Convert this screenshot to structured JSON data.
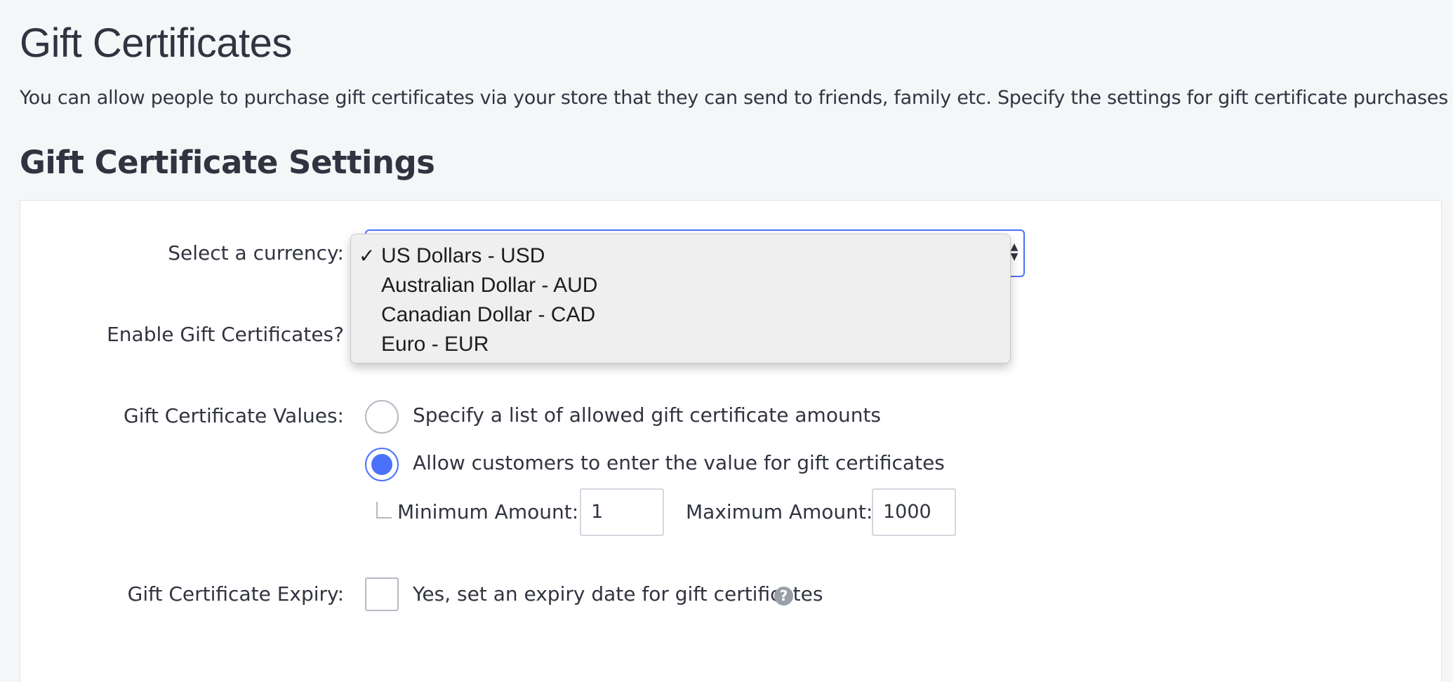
{
  "page": {
    "title": "Gift Certificates",
    "description": "You can allow people to purchase gift certificates via your store that they can send to friends, family etc. Specify the settings for gift certificate purchases below.",
    "section_title": "Gift Certificate Settings"
  },
  "currency": {
    "label": "Select a currency:",
    "selected": "US Dollars - USD",
    "check_glyph": "✓",
    "options": [
      "US Dollars - USD",
      "Australian Dollar - AUD",
      "Canadian Dollar - CAD",
      "Euro - EUR"
    ]
  },
  "enable": {
    "label": "Enable Gift Certificates?"
  },
  "values": {
    "label": "Gift Certificate Values:",
    "option_list": "Specify a list of allowed gift certificate amounts",
    "option_custom": "Allow customers to enter the value for gift certificates",
    "selected_option": "Allow customers to enter the value for gift certificates",
    "min_label": "Minimum Amount: $",
    "min_value": "1",
    "max_label": "Maximum Amount: $",
    "max_value": "1000"
  },
  "expiry": {
    "label": "Gift Certificate Expiry:",
    "checkbox_label": "Yes, set an expiry date for gift certificates",
    "help_glyph": "?"
  },
  "colors": {
    "accent": "#4b71fc",
    "text": "#313440",
    "background": "#f5f6f8"
  },
  "icons": {
    "select_arrows": "up-down-chevron-icon",
    "checkmark": "checkmark-icon",
    "help": "question-circle-icon"
  }
}
